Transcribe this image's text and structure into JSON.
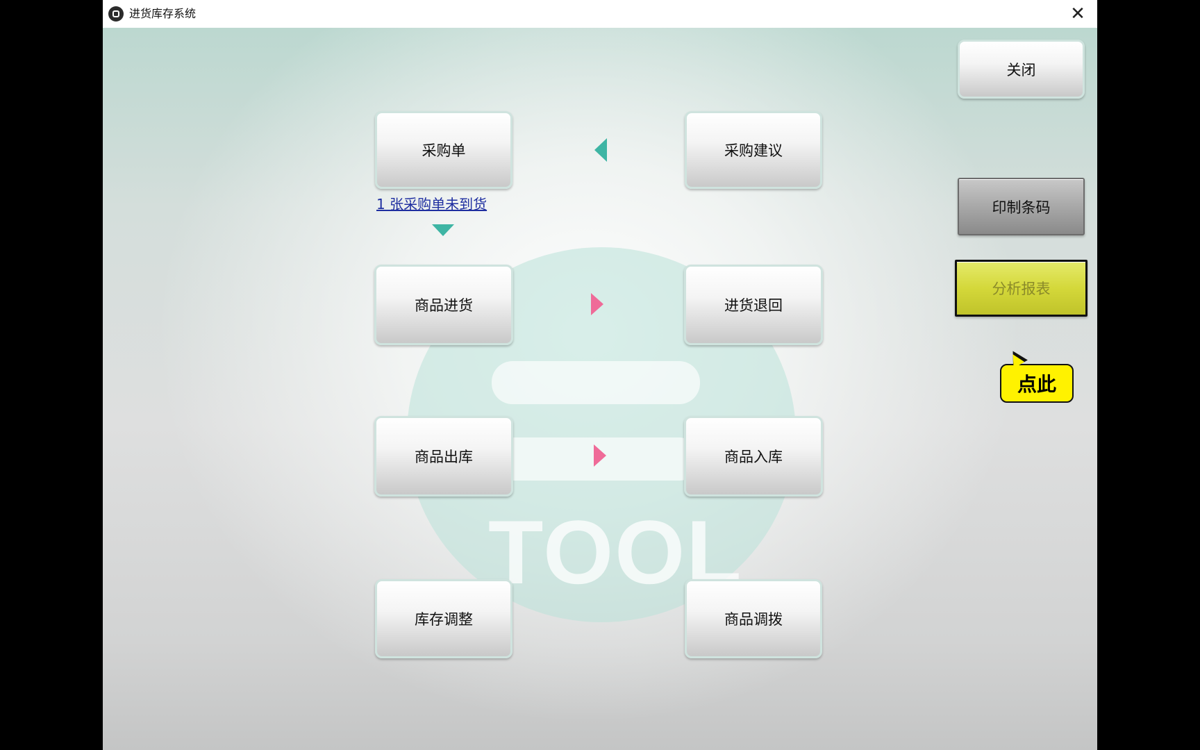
{
  "window": {
    "title": "进货库存系统",
    "close_glyph": "✕"
  },
  "main": {
    "purchase_order_label": "采购单",
    "purchase_suggestion_label": "采购建议",
    "pending_orders_link": "1 张采购单未到货",
    "goods_receiving_label": "商品进货",
    "purchase_return_label": "进货退回",
    "goods_outbound_label": "商品出库",
    "goods_inbound_label": "商品入库",
    "stock_adjust_label": "库存调整",
    "goods_transfer_label": "商品调拨"
  },
  "side": {
    "close_label": "关闭",
    "print_barcode_label": "印制条码",
    "analysis_report_label": "分析报表"
  },
  "callout": {
    "text": "点此"
  },
  "colors": {
    "teal_arrow": "#3eb5a4",
    "pink_arrow": "#ef6b98",
    "highlight": "#d4d83a",
    "callout": "#fff200"
  },
  "icons": {
    "app": "app-logo-icon",
    "close": "close-icon"
  }
}
